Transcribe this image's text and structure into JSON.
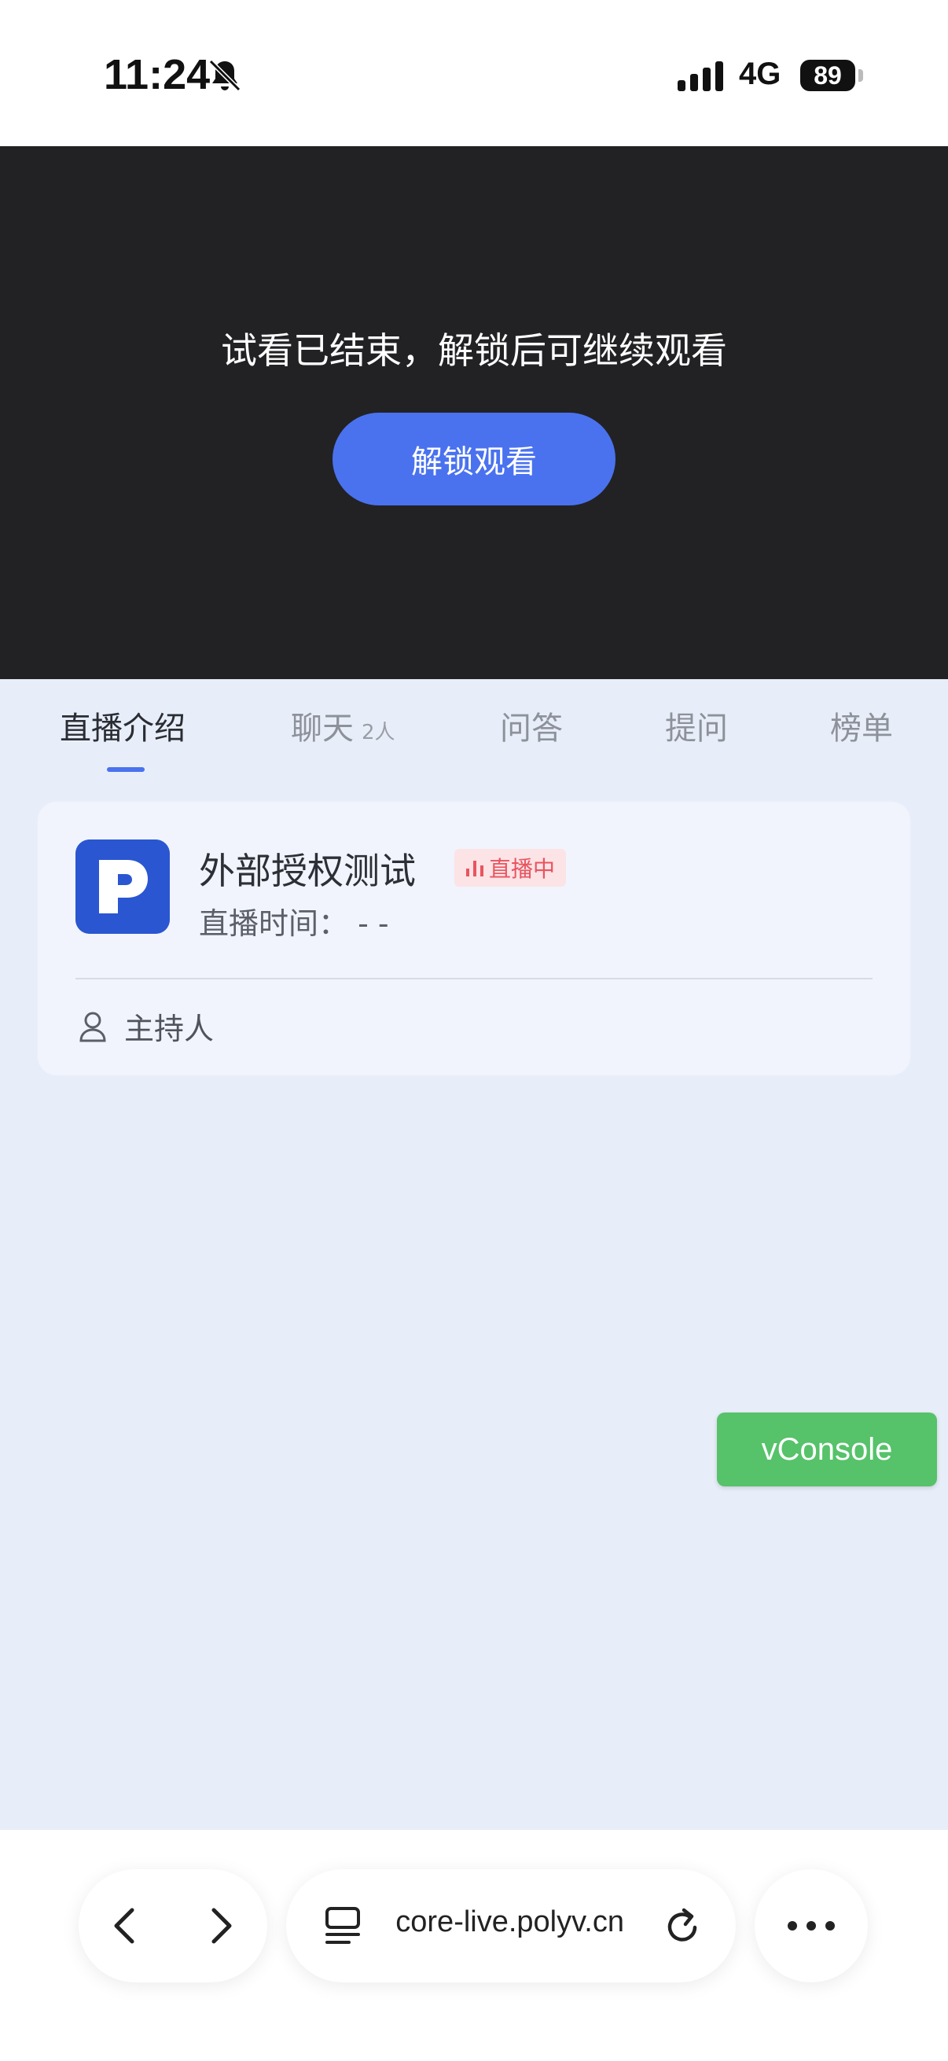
{
  "status_bar": {
    "time": "11:24",
    "network": "4G",
    "battery": "89"
  },
  "player": {
    "message": "试看已结束，解锁后可继续观看",
    "unlock_label": "解锁观看"
  },
  "tabs": {
    "intro": "直播介绍",
    "chat": "聊天",
    "chat_count": "2人",
    "qa": "问答",
    "ask": "提问",
    "ranking": "榜单"
  },
  "intro": {
    "title": "外部授权测试",
    "live_badge": "直播中",
    "live_time": "直播时间：  - -",
    "host_label": "主持人"
  },
  "vconsole": {
    "label": "vConsole"
  },
  "browser": {
    "url": "core-live.polyv.cn"
  },
  "colors": {
    "accent": "#4a72ef",
    "badge_text": "#e9545f",
    "vconsole": "#56c26a",
    "page_bg": "#e8eef9"
  },
  "icons": [
    "bell-muted-icon",
    "signal-icon",
    "battery-icon",
    "live-bars-icon",
    "user-icon",
    "back-icon",
    "forward-icon",
    "tabs-icon",
    "reload-icon",
    "more-icon",
    "polyv-logo"
  ]
}
